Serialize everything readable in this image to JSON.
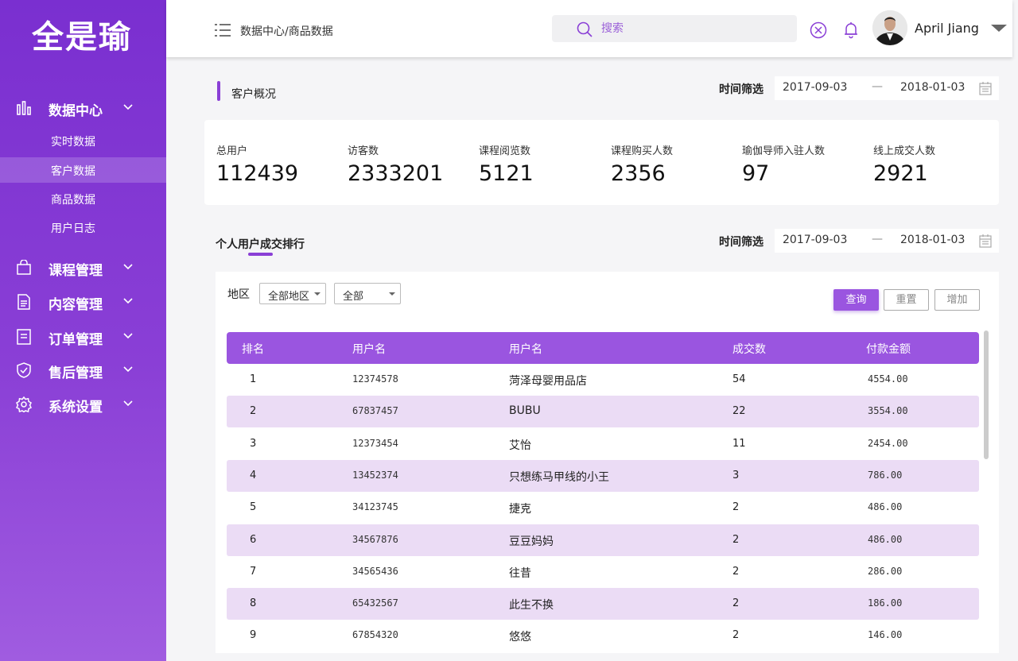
{
  "app": {
    "logo": "全是瑜"
  },
  "sidebar": {
    "groups": [
      {
        "label": "数据中心",
        "icon": "bar-chart-icon"
      },
      {
        "label": "课程管理",
        "icon": "shopping-bag-icon"
      },
      {
        "label": "内容管理",
        "icon": "document-icon"
      },
      {
        "label": "订单管理",
        "icon": "order-list-icon"
      },
      {
        "label": "售后管理",
        "icon": "shield-icon"
      },
      {
        "label": "系统设置",
        "icon": "gear-icon"
      }
    ],
    "sub_items": [
      "实时数据",
      "客户数据",
      "商品数据",
      "用户日志"
    ],
    "active_sub": "客户数据"
  },
  "header": {
    "breadcrumb": "数据中心/商品数据",
    "search_placeholder": "搜索",
    "username": "April Jiang"
  },
  "overview": {
    "title": "客户概况",
    "filter_label": "时间筛选",
    "date_start": "2017-09-03",
    "date_sep": "—",
    "date_end": "2018-01-03",
    "stats": [
      {
        "label": "总用户",
        "value": "112439"
      },
      {
        "label": "访客数",
        "value": "2333201"
      },
      {
        "label": "课程阅览数",
        "value": "5121"
      },
      {
        "label": "课程购买人数",
        "value": "2356"
      },
      {
        "label": "瑜伽导师入驻人数",
        "value": "97"
      },
      {
        "label": "线上成交人数",
        "value": "2921"
      }
    ]
  },
  "ranking": {
    "title": "个人用户成交排行",
    "filter_label": "时间筛选",
    "date_start": "2017-09-03",
    "date_sep": "—",
    "date_end": "2018-01-03",
    "region_label": "地区",
    "region_select": "全部地区",
    "type_select": "全部",
    "buttons": {
      "query": "查询",
      "reset": "重置",
      "add": "增加"
    },
    "columns": [
      "排名",
      "用户名",
      "用户名",
      "成交数",
      "付款金额"
    ],
    "rows": [
      [
        "1",
        "12374578",
        "菏泽母婴用品店",
        "54",
        "4554.00"
      ],
      [
        "2",
        "67837457",
        "BUBU",
        "22",
        "3554.00"
      ],
      [
        "3",
        "12373454",
        "艾怡",
        "11",
        "2454.00"
      ],
      [
        "4",
        "13452374",
        "只想练马甲线的小王",
        "3",
        "786.00"
      ],
      [
        "5",
        "34123745",
        "捷克",
        "2",
        "486.00"
      ],
      [
        "6",
        "34567876",
        "豆豆妈妈",
        "2",
        "486.00"
      ],
      [
        "7",
        "34565436",
        "往昔",
        "2",
        "286.00"
      ],
      [
        "8",
        "65432567",
        "此生不换",
        "2",
        "186.00"
      ],
      [
        "9",
        "67854320",
        "悠悠",
        "2",
        "146.00"
      ]
    ]
  },
  "colors": {
    "accent": "#8a3fd6",
    "row_alt": "#ebdcf5",
    "header": "#9a55e0"
  }
}
